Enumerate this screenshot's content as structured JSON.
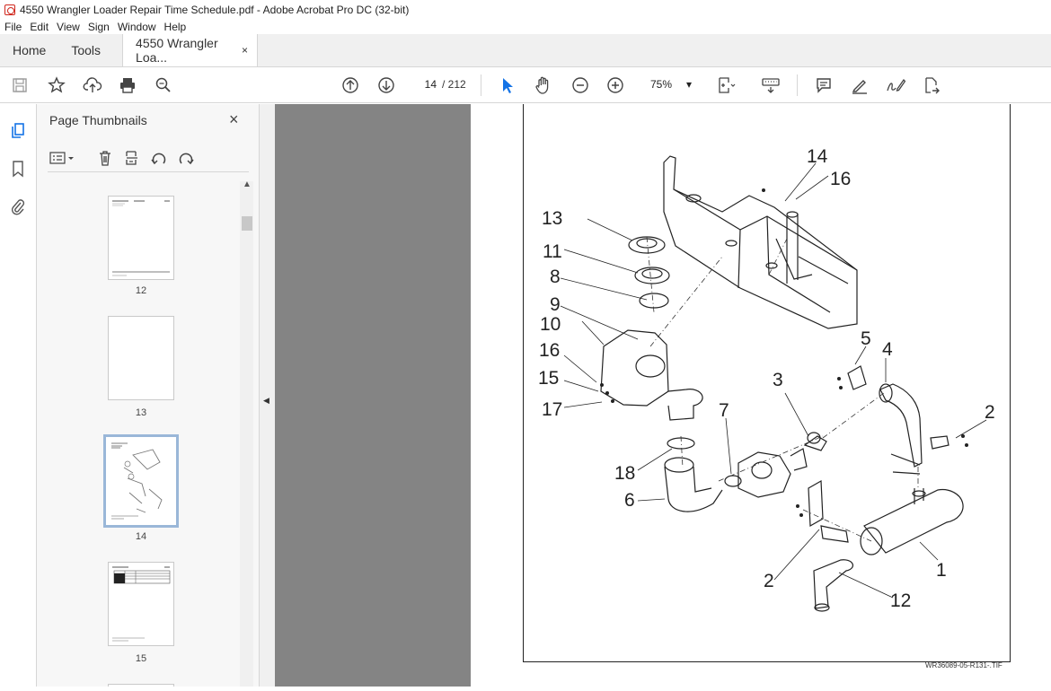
{
  "window": {
    "title": "4550 Wrangler Loader Repair Time Schedule.pdf - Adobe Acrobat Pro DC (32-bit)"
  },
  "menu": [
    "File",
    "Edit",
    "View",
    "Sign",
    "Window",
    "Help"
  ],
  "tabs": {
    "home": "Home",
    "tools": "Tools",
    "doc": "4550 Wrangler Loa...",
    "close": "×"
  },
  "toolbar": {
    "page_current": "14",
    "page_total": "/ 212",
    "zoom": "75%",
    "zoom_arrow": "▾"
  },
  "panel": {
    "title": "Page Thumbnails",
    "close": "×",
    "thumbnails": [
      {
        "label": "12",
        "selected": false
      },
      {
        "label": "13",
        "selected": false
      },
      {
        "label": "14",
        "selected": true
      },
      {
        "label": "15",
        "selected": false
      }
    ]
  },
  "document": {
    "callouts": [
      "14",
      "16",
      "13",
      "11",
      "8",
      "9",
      "10",
      "16",
      "15",
      "17",
      "5",
      "4",
      "3",
      "7",
      "2",
      "18",
      "6",
      "2",
      "1",
      "12"
    ],
    "caption": "WR36089-05-R131-.TIF"
  },
  "colors": {
    "accent": "#1473e6",
    "pdf_red": "#d0261c",
    "viewer_bg": "#848484"
  }
}
